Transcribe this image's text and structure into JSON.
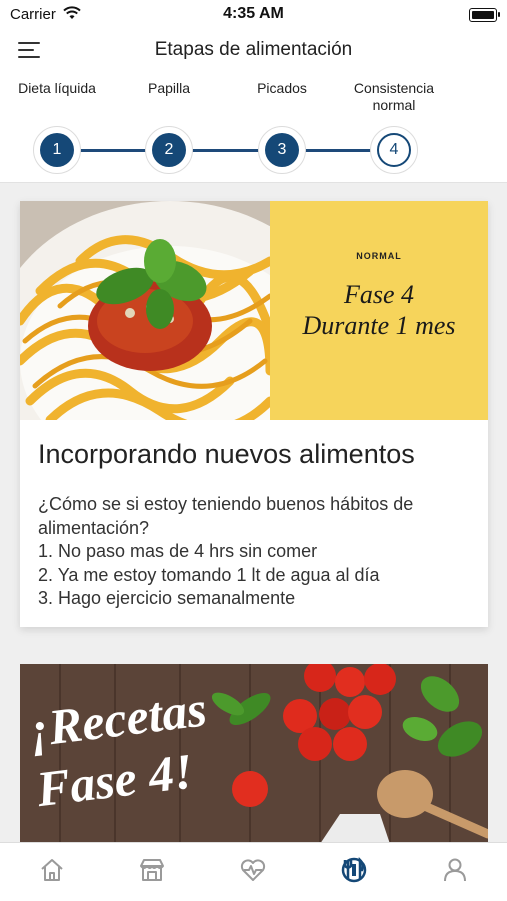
{
  "status_bar": {
    "carrier": "Carrier",
    "time": "4:35 AM"
  },
  "header": {
    "title": "Etapas de alimentación"
  },
  "steps": [
    {
      "label": "Dieta líquida",
      "number": "1"
    },
    {
      "label": "Papilla",
      "number": "2"
    },
    {
      "label": "Picados",
      "number": "3"
    },
    {
      "label": "Consistencia\nnormal",
      "number": "4",
      "active": true
    }
  ],
  "phase_card": {
    "tag": "NORMAL",
    "phase_line1": "Fase 4",
    "phase_line2": "Durante 1 mes",
    "heading": "Incorporando nuevos alimentos",
    "question": "¿Cómo se si estoy teniendo buenos hábitos de alimentación?",
    "items": [
      "1. No paso mas de 4 hrs sin comer",
      "2. Ya me estoy tomando 1 lt de agua al día",
      "3. Hago ejercicio semanalmente"
    ]
  },
  "recipes_banner": {
    "line1": "¡Recetas",
    "line2": "Fase 4!"
  },
  "tab_bar": {
    "tabs": [
      {
        "icon": "home-icon"
      },
      {
        "icon": "store-icon"
      },
      {
        "icon": "heart-pulse-icon"
      },
      {
        "icon": "food-utensils-icon",
        "active": true
      },
      {
        "icon": "user-icon"
      }
    ],
    "active_color": "#154877",
    "inactive_color": "#9a9a9a"
  },
  "colors": {
    "accent": "#154877",
    "phase_yellow": "#f6d45b"
  }
}
